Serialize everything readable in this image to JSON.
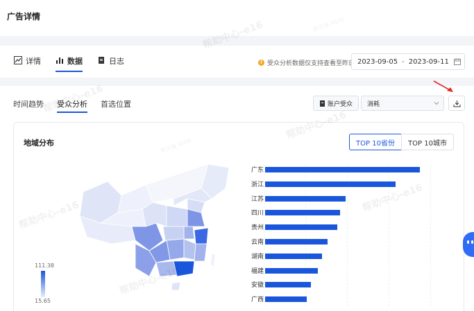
{
  "header": {
    "title": "广告详情"
  },
  "tabs": [
    {
      "label": "详情",
      "icon": "trend-chart-icon",
      "active": false
    },
    {
      "label": "数据",
      "icon": "bar-chart-icon",
      "active": true
    },
    {
      "label": "日志",
      "icon": "document-icon",
      "active": false
    }
  ],
  "notice": {
    "text": "受众分析数据仅支持查看至昨日",
    "icon": "warning-icon"
  },
  "date_range": {
    "start": "2023-09-05",
    "separator": "-",
    "end": "2023-09-11",
    "icon": "calendar-icon"
  },
  "subtabs": [
    {
      "label": "时间趋势",
      "active": false
    },
    {
      "label": "受众分析",
      "active": true
    },
    {
      "label": "首选位置",
      "active": false
    }
  ],
  "toolbar": {
    "account_button": "账户受众",
    "metric_select": "消耗",
    "download_icon": "download-icon"
  },
  "geo": {
    "title": "地域分布",
    "toggles": [
      {
        "label": "TOP 10省份",
        "active": true
      },
      {
        "label": "TOP 10城市",
        "active": false
      }
    ],
    "legend_max": "111.38",
    "legend_min": "15.65"
  },
  "chart_data": {
    "type": "bar",
    "orientation": "horizontal",
    "categories": [
      "广东",
      "浙江",
      "江苏",
      "四川",
      "贵州",
      "云南",
      "湖南",
      "福建",
      "安徽",
      "广西"
    ],
    "values": [
      111.38,
      94,
      58,
      54,
      52,
      45,
      41,
      38,
      33,
      30
    ],
    "xlim": [
      0,
      120
    ],
    "color": "#1a56db",
    "grid": true
  },
  "watermark": {
    "text": "帮助中心-e16",
    "small_text": "李文強 9608"
  },
  "colors": {
    "accent": "#1a56db",
    "warning": "#f5a623",
    "arrow": "#e02424"
  }
}
